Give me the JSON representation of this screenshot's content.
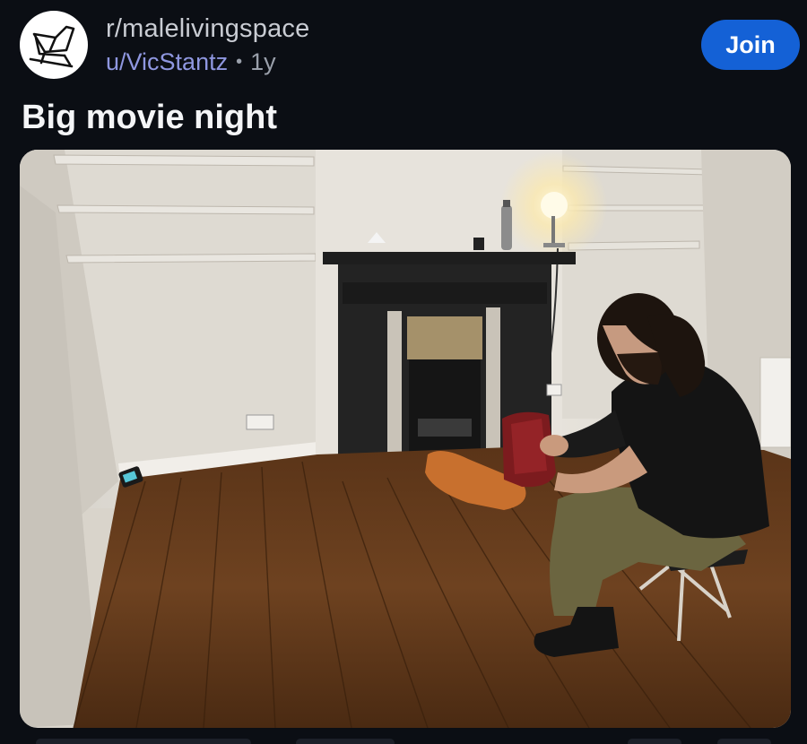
{
  "header": {
    "community": "r/malelivingspace",
    "author": "u/VicStantz",
    "separator": "•",
    "age": "1y",
    "join_label": "Join",
    "avatar_icon": "armchair-icon"
  },
  "post": {
    "title": "Big movie night",
    "media_icon": "photo-room-with-fireplace"
  },
  "colors": {
    "background": "#0b0e14",
    "join_button": "#1461d6",
    "author_link": "#8f97e0"
  }
}
